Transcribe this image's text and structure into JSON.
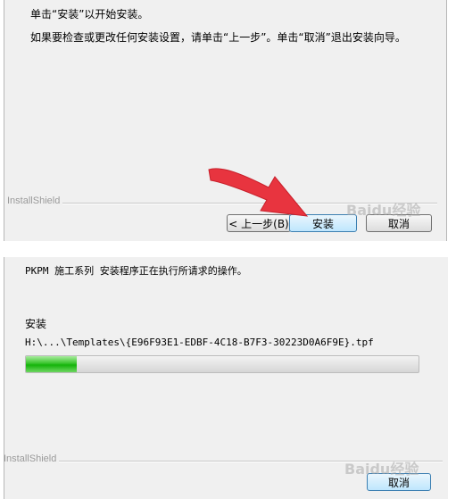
{
  "top_dialog": {
    "line1": "单击“安装”以开始安装。",
    "line2": "如果要检查或更改任何安装设置，请单击“上一步”。单击“取消”退出安装向导。",
    "brand": "InstallShield",
    "buttons": {
      "back": "< 上一步(B)",
      "install": "安装",
      "cancel": "取消"
    }
  },
  "bottom_dialog": {
    "status": "PKPM 施工系列 安装程序正在执行所请求的操作。",
    "phase": "安装",
    "file_path": "H:\\...\\Templates\\{E96F93E1-EDBF-4C18-B7F3-30223D0A6F9E}.tpf",
    "progress": 0.13,
    "brand": "InstallShield",
    "cancel": "取消"
  },
  "watermark": "Baidu经验",
  "colors": {
    "arrow": "#e8343f",
    "progress_fill": "#22b814",
    "focus_border": "#3c7fb1"
  },
  "icons": [
    "red-arrow-annotation-icon"
  ]
}
